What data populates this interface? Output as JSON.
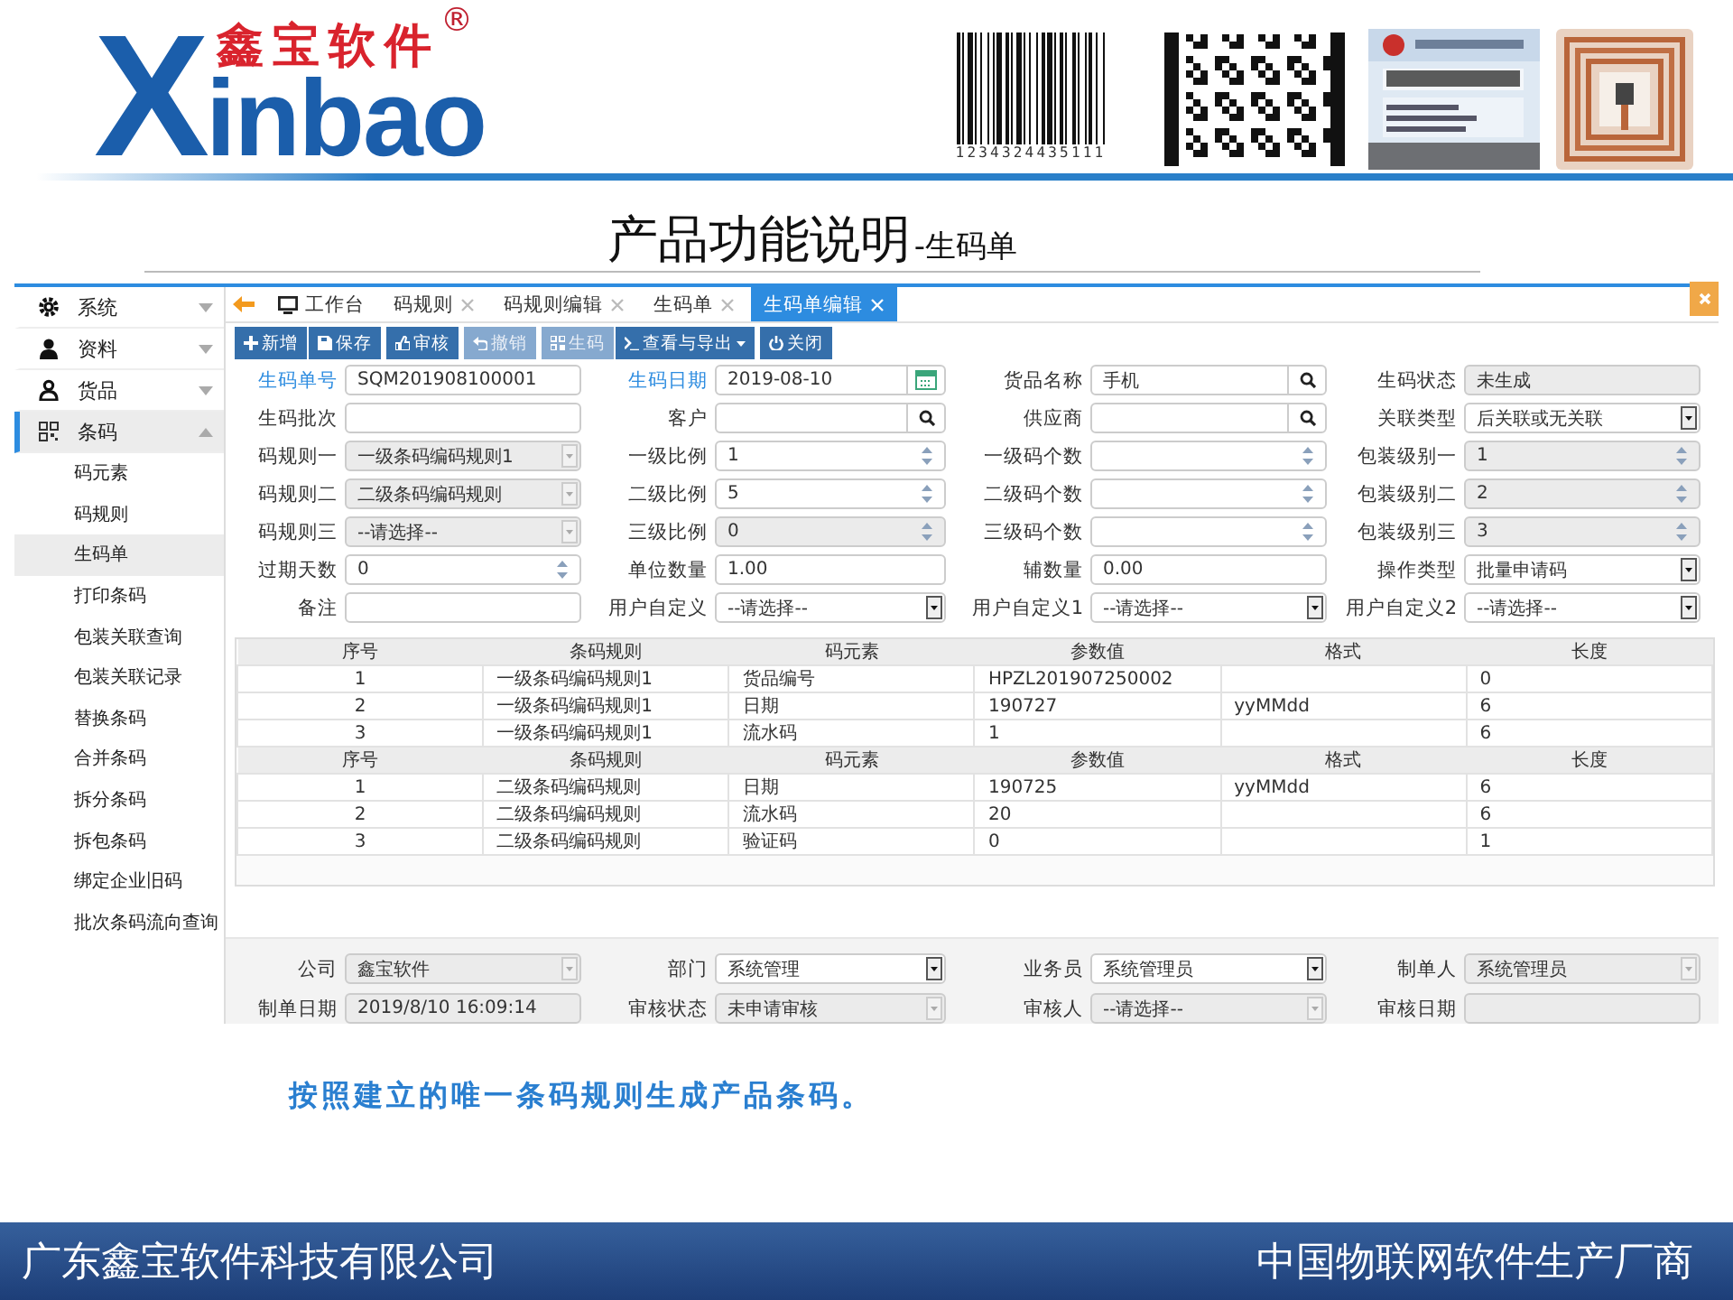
{
  "header": {
    "logo": {
      "initial": "X",
      "latin": "inbao",
      "chinese": "鑫宝软件",
      "mark": "®"
    },
    "barcode_number": "1234324435111"
  },
  "title": {
    "main": "产品功能说明",
    "sub": "-生码单"
  },
  "app": {
    "sidebar": [
      {
        "label": "系统",
        "expanded": false,
        "selected": false
      },
      {
        "label": "资料",
        "expanded": false,
        "selected": false
      },
      {
        "label": "货品",
        "expanded": false,
        "selected": false
      },
      {
        "label": "条码",
        "expanded": true,
        "selected": true,
        "children": [
          {
            "label": "码元素",
            "selected": false
          },
          {
            "label": "码规则",
            "selected": false
          },
          {
            "label": "生码单",
            "selected": true
          },
          {
            "label": "打印条码",
            "selected": false
          },
          {
            "label": "包装关联查询",
            "selected": false
          },
          {
            "label": "包装关联记录",
            "selected": false
          },
          {
            "label": "替换条码",
            "selected": false
          },
          {
            "label": "合并条码",
            "selected": false
          },
          {
            "label": "拆分条码",
            "selected": false
          },
          {
            "label": "拆包条码",
            "selected": false
          },
          {
            "label": "绑定企业旧码",
            "selected": false
          },
          {
            "label": "批次条码流向查询",
            "selected": false
          }
        ]
      }
    ],
    "tabs": [
      {
        "label": "工作台",
        "kind": "home",
        "closable": false,
        "selected": false
      },
      {
        "label": "码规则",
        "kind": "page",
        "closable": true,
        "selected": false
      },
      {
        "label": "码规则编辑",
        "kind": "page",
        "closable": true,
        "selected": false
      },
      {
        "label": "生码单",
        "kind": "page",
        "closable": true,
        "selected": false
      },
      {
        "label": "生码单编辑",
        "kind": "page",
        "closable": true,
        "selected": true
      }
    ],
    "toolbar": [
      {
        "buttons": [
          {
            "label": "新增",
            "disabled": false,
            "dropdown": false
          },
          {
            "label": "保存",
            "disabled": false,
            "dropdown": false
          }
        ]
      },
      {
        "buttons": [
          {
            "label": "审核",
            "disabled": false,
            "dropdown": false
          }
        ]
      },
      {
        "buttons": [
          {
            "label": "撤销",
            "disabled": true,
            "dropdown": false
          }
        ]
      },
      {
        "buttons": [
          {
            "label": "生码",
            "disabled": true,
            "dropdown": false
          },
          {
            "label": "查看与导出",
            "disabled": false,
            "dropdown": true
          }
        ]
      },
      {
        "buttons": [
          {
            "label": "关闭",
            "disabled": false,
            "dropdown": false
          }
        ]
      }
    ],
    "form": [
      {
        "label": "生码单号",
        "kind": "text",
        "value": "SQM201908100001",
        "required": true,
        "disabled": false
      },
      {
        "label": "生码日期",
        "kind": "date",
        "value": "2019-08-10",
        "required": true,
        "disabled": false
      },
      {
        "label": "货品名称",
        "kind": "lookup",
        "value": "手机",
        "required": false,
        "disabled": false
      },
      {
        "label": "生码状态",
        "kind": "text",
        "value": "未生成",
        "required": false,
        "disabled": true
      },
      {
        "label": "生码批次",
        "kind": "text",
        "required": false,
        "disabled": false
      },
      {
        "label": "客户",
        "kind": "lookup",
        "required": false,
        "disabled": false
      },
      {
        "label": "供应商",
        "kind": "lookup",
        "required": false,
        "disabled": false
      },
      {
        "label": "关联类型",
        "kind": "select",
        "value": "后关联或无关联",
        "required": false,
        "disabled": false
      },
      {
        "label": "码规则一",
        "kind": "select",
        "value": "一级条码编码规则1",
        "required": false,
        "disabled": true
      },
      {
        "label": "一级比例",
        "kind": "spin",
        "value": "1",
        "required": false,
        "disabled": false
      },
      {
        "label": "一级码个数",
        "kind": "spin",
        "required": false,
        "disabled": false
      },
      {
        "label": "包装级别一",
        "kind": "spin",
        "value": "1",
        "required": false,
        "disabled": true
      },
      {
        "label": "码规则二",
        "kind": "select",
        "value": "二级条码编码规则",
        "required": false,
        "disabled": true
      },
      {
        "label": "二级比例",
        "kind": "spin",
        "value": "5",
        "required": false,
        "disabled": false
      },
      {
        "label": "二级码个数",
        "kind": "spin",
        "required": false,
        "disabled": false
      },
      {
        "label": "包装级别二",
        "kind": "spin",
        "value": "2",
        "required": false,
        "disabled": true
      },
      {
        "label": "码规则三",
        "kind": "select",
        "value": "--请选择--",
        "required": false,
        "disabled": true
      },
      {
        "label": "三级比例",
        "kind": "spin",
        "value": "0",
        "required": false,
        "disabled": true
      },
      {
        "label": "三级码个数",
        "kind": "spin",
        "required": false,
        "disabled": false
      },
      {
        "label": "包装级别三",
        "kind": "spin",
        "value": "3",
        "required": false,
        "disabled": true
      },
      {
        "label": "过期天数",
        "kind": "spin",
        "value": "0",
        "required": false,
        "disabled": false
      },
      {
        "label": "单位数量",
        "kind": "text",
        "value": "1.00",
        "required": false,
        "disabled": false
      },
      {
        "label": "辅数量",
        "kind": "text",
        "value": "0.00",
        "required": false,
        "disabled": false
      },
      {
        "label": "操作类型",
        "kind": "select",
        "value": "批量申请码",
        "required": false,
        "disabled": false
      },
      {
        "label": "备注",
        "kind": "text",
        "required": false,
        "disabled": false
      },
      {
        "label": "用户自定义",
        "kind": "select",
        "value": "--请选择--",
        "required": false,
        "disabled": false
      },
      {
        "label": "用户自定义1",
        "kind": "select",
        "value": "--请选择--",
        "required": false,
        "disabled": false
      },
      {
        "label": "用户自定义2",
        "kind": "select",
        "value": "--请选择--",
        "required": false,
        "disabled": false
      }
    ],
    "grids": [
      {
        "columns": [
          "序号",
          "条码规则",
          "码元素",
          "参数值",
          "格式",
          "长度"
        ],
        "rows": [
          [
            "1",
            "一级条码编码规则1",
            "货品编号",
            "HPZL201907250002",
            null,
            "0"
          ],
          [
            "2",
            "一级条码编码规则1",
            "日期",
            "190727",
            "yyMMdd",
            "6"
          ],
          [
            "3",
            "一级条码编码规则1",
            "流水码",
            "1",
            null,
            "6"
          ]
        ]
      },
      {
        "columns": [
          "序号",
          "条码规则",
          "码元素",
          "参数值",
          "格式",
          "长度"
        ],
        "rows": [
          [
            "1",
            "二级条码编码规则",
            "日期",
            "190725",
            "yyMMdd",
            "6"
          ],
          [
            "2",
            "二级条码编码规则",
            "流水码",
            "20",
            null,
            "6"
          ],
          [
            "3",
            "二级条码编码规则",
            "验证码",
            "0",
            null,
            "1"
          ]
        ]
      }
    ],
    "footer_form": [
      {
        "label": "公司",
        "kind": "select",
        "value": "鑫宝软件",
        "disabled": true
      },
      {
        "label": "部门",
        "kind": "select",
        "value": "系统管理",
        "disabled": false
      },
      {
        "label": "业务员",
        "kind": "select",
        "value": "系统管理员",
        "disabled": false
      },
      {
        "label": "制单人",
        "kind": "select",
        "value": "系统管理员",
        "disabled": true
      },
      {
        "label": "制单日期",
        "kind": "text",
        "value": "2019/8/10 16:09:14",
        "disabled": true
      },
      {
        "label": "审核状态",
        "kind": "select",
        "value": "未申请审核",
        "disabled": true
      },
      {
        "label": "审核人",
        "kind": "select",
        "value": "--请选择--",
        "disabled": true
      },
      {
        "label": "审核日期",
        "kind": "text",
        "disabled": true
      }
    ]
  },
  "caption": "按照建立的唯一条码规则生成产品条码。",
  "footer": {
    "company": "广东鑫宝软件科技有限公司",
    "slogan": "中国物联网软件生产厂商"
  }
}
